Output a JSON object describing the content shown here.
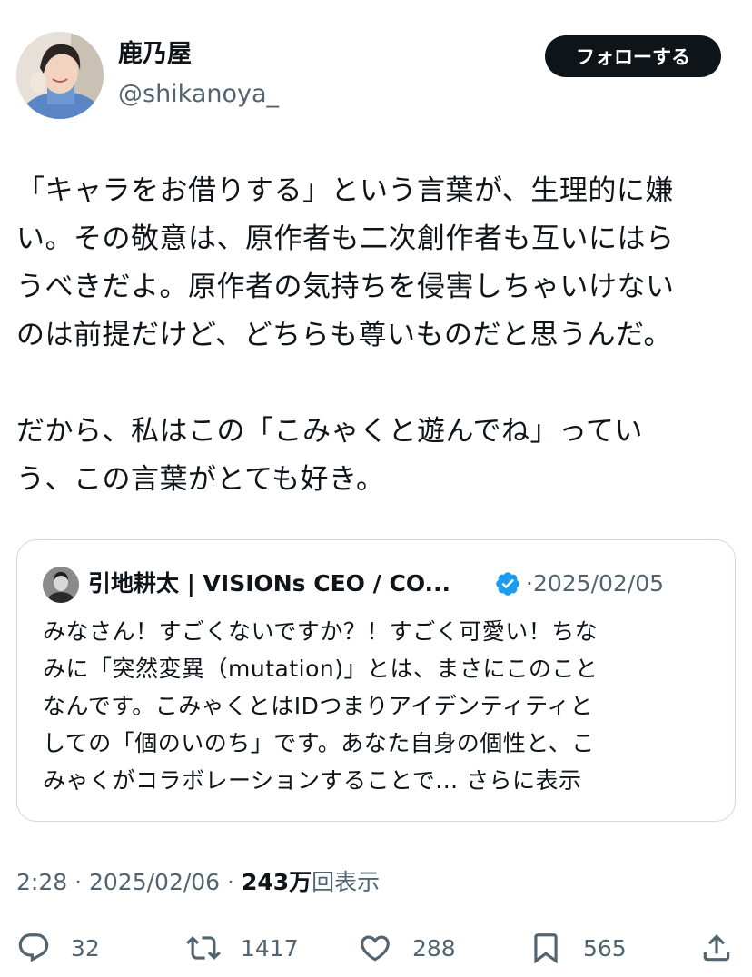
{
  "author": {
    "display_name": "鹿乃屋",
    "handle": "@shikanoya_",
    "avatar_icon": "profile-photo-avatar"
  },
  "follow_button": {
    "label": "フォローする"
  },
  "tweet": {
    "lines": [
      "「キャラをお借りする」という言葉が、生理的に嫌",
      "い。その敬意は、原作者も二次創作者も互いにはら",
      "うべきだよ。原作者の気持ちを侵害しちゃいけない",
      "のは前提だけど、どちらも尊いものだと思うんだ。",
      "",
      "だから、私はこの「こみゃくと遊んでね」ってい",
      "う、この言葉がとても好き。"
    ]
  },
  "quote": {
    "display_name": "引地耕太 | VISIONs CEO / CO...",
    "verified_icon": "verified-badge-icon",
    "separator": "·",
    "date": "2025/02/05",
    "lines": [
      "みなさん！すごくないですか？！すごく可愛い！ちな",
      "みに「突然変異（mutation)」とは、まさにこのこと",
      "なんです。こみゃくとはIDつまりアイデンティティと",
      "しての「個のいのち」です。あなた自身の個性と、こ"
    ],
    "last_line": "みゃくがコラボレーションすることで...",
    "show_more": "さらに表示"
  },
  "meta": {
    "time": "2:28",
    "separator": "·",
    "date": "2025/02/06",
    "views_count": "243万",
    "views_label": "回表示"
  },
  "actions": {
    "reply": {
      "icon": "reply-icon",
      "count": "32"
    },
    "repost": {
      "icon": "repost-icon",
      "count": "1417"
    },
    "like": {
      "icon": "heart-icon",
      "count": "288"
    },
    "bookmark": {
      "icon": "bookmark-icon",
      "count": "565"
    },
    "share": {
      "icon": "share-icon"
    }
  },
  "colors": {
    "text": "#0f1419",
    "secondary": "#536471",
    "border": "#cfd9de",
    "verified": "#1d9bf0",
    "button_bg": "#0f1419"
  }
}
